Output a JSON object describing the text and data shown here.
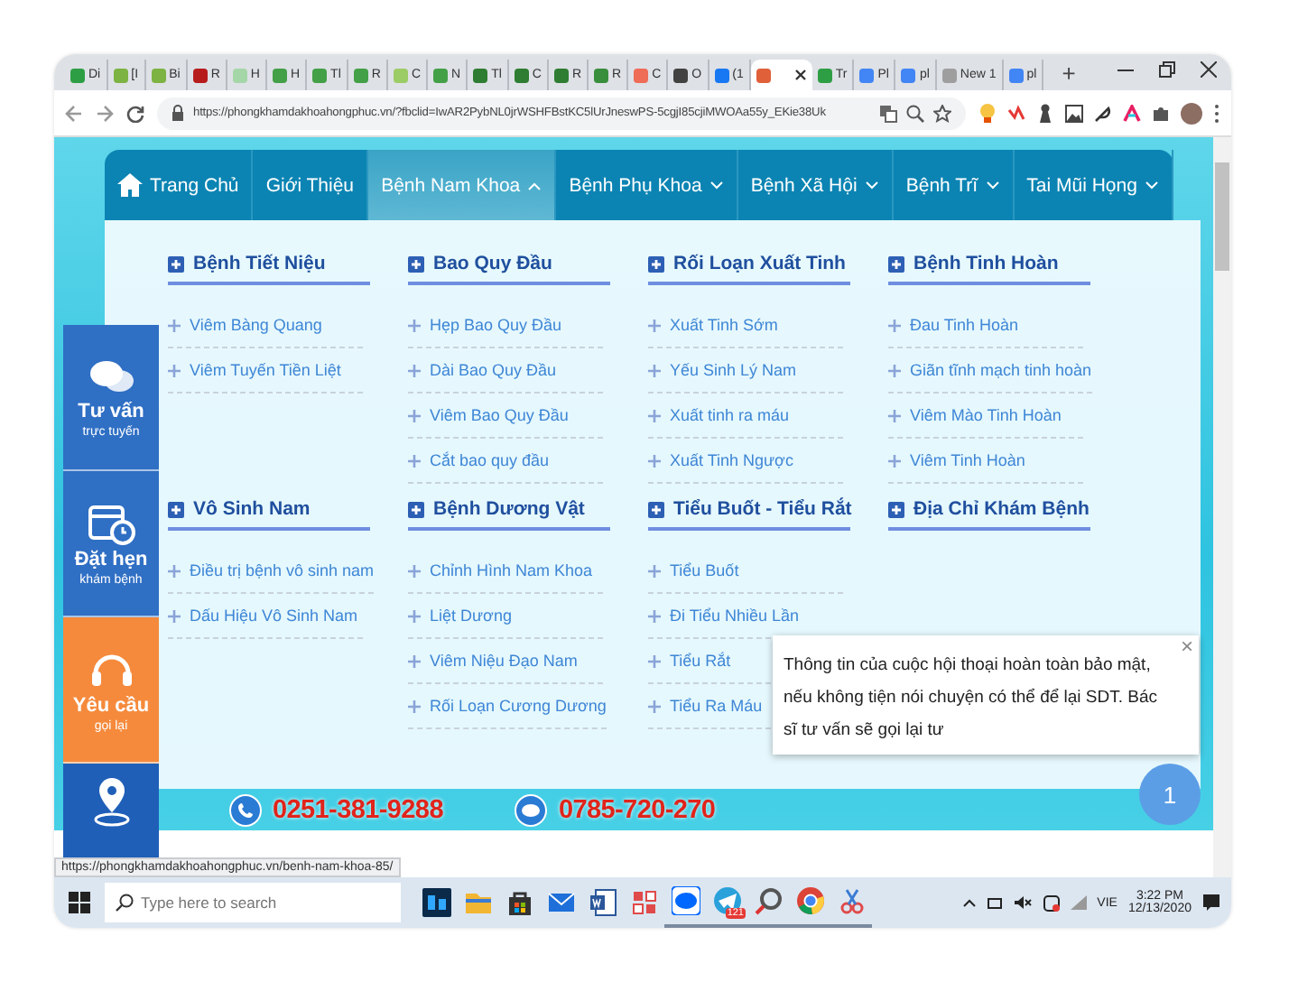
{
  "browser": {
    "tabs": [
      {
        "label": "Di",
        "color": "#2e9e44",
        "selected": false
      },
      {
        "label": "[I",
        "color": "#7cb342",
        "selected": false
      },
      {
        "label": "Bi",
        "color": "#7cb342",
        "selected": false
      },
      {
        "label": "R",
        "color": "#b71c1c",
        "selected": false
      },
      {
        "label": "H",
        "color": "#a5d6a7",
        "selected": false
      },
      {
        "label": "H",
        "color": "#43a047",
        "selected": false
      },
      {
        "label": "Tl",
        "color": "#43a047",
        "selected": false
      },
      {
        "label": "R",
        "color": "#43a047",
        "selected": false
      },
      {
        "label": "C",
        "color": "#9ccc65",
        "selected": false
      },
      {
        "label": "N",
        "color": "#43a047",
        "selected": false
      },
      {
        "label": "Tl",
        "color": "#2e7d32",
        "selected": false
      },
      {
        "label": "C",
        "color": "#2e7d32",
        "selected": false
      },
      {
        "label": "R",
        "color": "#2e7d32",
        "selected": false
      },
      {
        "label": "R",
        "color": "#388e3c",
        "selected": false
      },
      {
        "label": "C",
        "color": "#ef6c57",
        "selected": false
      },
      {
        "label": "O",
        "color": "#424242",
        "selected": false
      },
      {
        "label": "(1",
        "color": "#1877f2",
        "selected": false
      },
      {
        "color": "#e0603a",
        "selected": true
      },
      {
        "label": "Tr",
        "color": "#2e9e44",
        "selected": false
      },
      {
        "label": "Pl",
        "color": "#4285f4",
        "selected": false
      },
      {
        "label": "pl",
        "color": "#4285f4",
        "selected": false
      },
      {
        "label": "New 1",
        "color": "#9e9e9e",
        "selected": false
      },
      {
        "label": "pl",
        "color": "#4285f4",
        "selected": false
      }
    ],
    "new_tab": "+",
    "url": "https://phongkhamdakhoahongphuc.vn/?fbclid=IwAR2PybNL0jrWSHFBstKC5lUrJneswPS-5cgjI85cjiMWOAa55y_EKie38Uk",
    "status_url": "https://phongkhamdakhoahongphuc.vn/benh-nam-khoa-85/"
  },
  "nav": [
    {
      "label": "Trang Chủ",
      "kind": "home",
      "selected": false
    },
    {
      "label": "Giới Thiệu",
      "kind": "plain",
      "selected": false
    },
    {
      "label": "Bệnh Nam Khoa",
      "kind": "dropdown",
      "selected": true
    },
    {
      "label": "Bệnh Phụ Khoa",
      "kind": "dropdown",
      "selected": false
    },
    {
      "label": "Bệnh Xã Hội",
      "kind": "dropdown",
      "selected": false
    },
    {
      "label": "Bệnh Trĩ",
      "kind": "dropdown",
      "selected": false
    },
    {
      "label": "Tai Mũi Họng",
      "kind": "dropdown",
      "selected": false
    }
  ],
  "menu_groups": [
    {
      "title": "Bệnh Tiết Niệu",
      "items": [
        "Viêm Bàng Quang",
        "Viêm Tuyến Tiền Liệt"
      ]
    },
    {
      "title": "Bao Quy Đầu",
      "items": [
        "Hẹp Bao Quy Đầu",
        "Dài Bao Quy Đầu",
        "Viêm Bao Quy Đầu",
        "Cắt bao quy đầu"
      ]
    },
    {
      "title": "Rối Loạn Xuất Tinh",
      "items": [
        "Xuất Tinh Sớm",
        "Yếu Sinh Lý Nam",
        "Xuất tinh ra máu",
        "Xuất Tinh Ngược"
      ]
    },
    {
      "title": "Bệnh Tinh Hoàn",
      "items": [
        "Đau Tinh Hoàn",
        "Giãn tĩnh mạch tinh hoàn",
        "Viêm Mào Tinh Hoàn",
        "Viêm Tinh Hoàn"
      ]
    },
    {
      "title": "Vô Sinh Nam",
      "items": [
        "Điều trị bệnh vô sinh nam",
        "Dấu Hiệu Vô Sinh Nam"
      ]
    },
    {
      "title": "Bệnh Dương Vật",
      "items": [
        "Chỉnh Hình Nam Khoa",
        "Liệt Dương",
        "Viêm Niệu Đạo Nam",
        "Rối Loạn Cương Dương"
      ]
    },
    {
      "title": "Tiểu Buốt - Tiểu Rắt",
      "items": [
        "Tiểu Buốt",
        "Đi Tiểu Nhiều Lần",
        "Tiểu Rắt",
        "Tiểu Ra Máu"
      ]
    },
    {
      "title": "Địa Chỉ Khám Bệnh"
    }
  ],
  "sidebar": [
    {
      "kind": "chat",
      "title": "Tư vấn",
      "subtitle": "trực tuyến",
      "color": "#2f6fc4"
    },
    {
      "kind": "calendar",
      "title": "Đặt hẹn",
      "subtitle": "khám bệnh",
      "color": "#2f6fc4"
    },
    {
      "kind": "headset",
      "title": "Yêu cầu",
      "subtitle": "gọi lại",
      "color": "#f58a3c"
    },
    {
      "kind": "map",
      "color": "#1f5fb8"
    }
  ],
  "hotlines": [
    {
      "kind": "phone",
      "number": "0251-381-9288"
    },
    {
      "kind": "zalo",
      "number": "0785-720-270"
    }
  ],
  "chat_popup": {
    "message": "Thông tin của cuộc hội thoại hoàn toàn bảo mật, nếu không tiện nói chuyện có thể để lại SDT. Bác sĩ tư vấn sẽ gọi lại tư",
    "close": "×"
  },
  "unread_count": "1",
  "taskbar": {
    "search_placeholder": "Type here to search",
    "apps": [
      {
        "kind": "photoshop",
        "color": "#0b2a4a",
        "running": false
      },
      {
        "kind": "folder",
        "color": "#f2b632",
        "running": false
      },
      {
        "kind": "store",
        "color": "#333333",
        "running": false
      },
      {
        "kind": "mail",
        "color": "#1e6fd9",
        "running": false
      },
      {
        "kind": "word",
        "color": "#2b579a",
        "running": false
      },
      {
        "kind": "tiles",
        "color": "#e04a4a",
        "running": false
      },
      {
        "kind": "zalo",
        "color": "#0068ff",
        "running": true
      },
      {
        "kind": "telegram",
        "color": "#2aa1da",
        "running": true,
        "badge": "121"
      },
      {
        "kind": "magnifier",
        "color": "#555555",
        "running": true
      },
      {
        "kind": "chrome",
        "color": "#db4437",
        "running": true
      },
      {
        "kind": "snip",
        "color": "#e04a4a",
        "running": true
      }
    ],
    "language": "VIE",
    "time": "3:22 PM",
    "date": "12/13/2020"
  }
}
